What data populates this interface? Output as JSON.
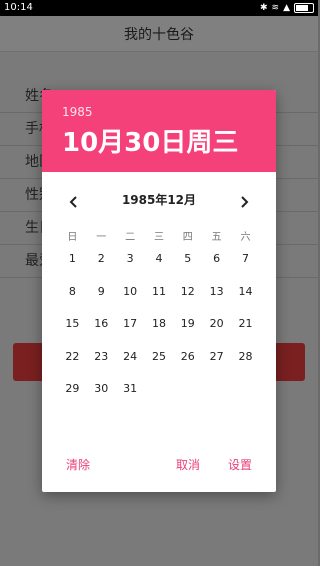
{
  "statusbar": {
    "time": "10:14"
  },
  "app": {
    "title": "我的十色谷",
    "form_labels": [
      "姓名",
      "手机",
      "地区",
      "性别",
      "生日",
      "最爱"
    ]
  },
  "dialog": {
    "header": {
      "year": "1985",
      "date": "10月30日周三"
    },
    "month_title": "1985年12月",
    "weekdays": [
      "日",
      "一",
      "二",
      "三",
      "四",
      "五",
      "六"
    ],
    "weeks": [
      [
        "1",
        "2",
        "3",
        "4",
        "5",
        "6",
        "7"
      ],
      [
        "8",
        "9",
        "10",
        "11",
        "12",
        "13",
        "14"
      ],
      [
        "15",
        "16",
        "17",
        "18",
        "19",
        "20",
        "21"
      ],
      [
        "22",
        "23",
        "24",
        "25",
        "26",
        "27",
        "28"
      ],
      [
        "29",
        "30",
        "31",
        "",
        "",
        "",
        ""
      ]
    ],
    "actions": {
      "clear": "清除",
      "cancel": "取消",
      "ok": "设置"
    },
    "accent_color": "#f5417a"
  }
}
